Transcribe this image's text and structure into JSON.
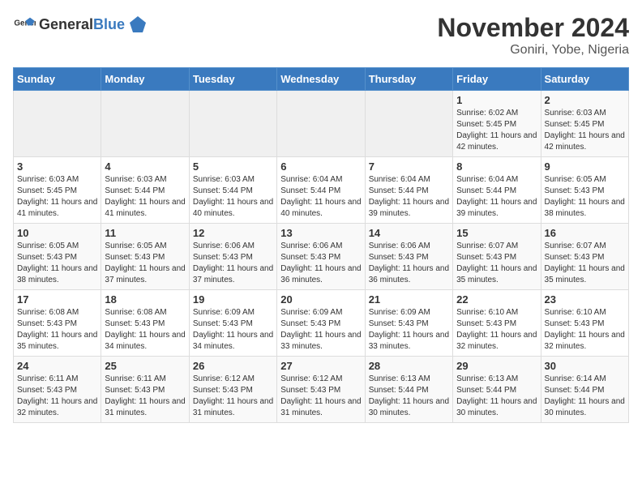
{
  "header": {
    "logo_general": "General",
    "logo_blue": "Blue",
    "month_year": "November 2024",
    "location": "Goniri, Yobe, Nigeria"
  },
  "weekdays": [
    "Sunday",
    "Monday",
    "Tuesday",
    "Wednesday",
    "Thursday",
    "Friday",
    "Saturday"
  ],
  "weeks": [
    [
      {
        "day": "",
        "info": ""
      },
      {
        "day": "",
        "info": ""
      },
      {
        "day": "",
        "info": ""
      },
      {
        "day": "",
        "info": ""
      },
      {
        "day": "",
        "info": ""
      },
      {
        "day": "1",
        "info": "Sunrise: 6:02 AM\nSunset: 5:45 PM\nDaylight: 11 hours and 42 minutes."
      },
      {
        "day": "2",
        "info": "Sunrise: 6:03 AM\nSunset: 5:45 PM\nDaylight: 11 hours and 42 minutes."
      }
    ],
    [
      {
        "day": "3",
        "info": "Sunrise: 6:03 AM\nSunset: 5:45 PM\nDaylight: 11 hours and 41 minutes."
      },
      {
        "day": "4",
        "info": "Sunrise: 6:03 AM\nSunset: 5:44 PM\nDaylight: 11 hours and 41 minutes."
      },
      {
        "day": "5",
        "info": "Sunrise: 6:03 AM\nSunset: 5:44 PM\nDaylight: 11 hours and 40 minutes."
      },
      {
        "day": "6",
        "info": "Sunrise: 6:04 AM\nSunset: 5:44 PM\nDaylight: 11 hours and 40 minutes."
      },
      {
        "day": "7",
        "info": "Sunrise: 6:04 AM\nSunset: 5:44 PM\nDaylight: 11 hours and 39 minutes."
      },
      {
        "day": "8",
        "info": "Sunrise: 6:04 AM\nSunset: 5:44 PM\nDaylight: 11 hours and 39 minutes."
      },
      {
        "day": "9",
        "info": "Sunrise: 6:05 AM\nSunset: 5:43 PM\nDaylight: 11 hours and 38 minutes."
      }
    ],
    [
      {
        "day": "10",
        "info": "Sunrise: 6:05 AM\nSunset: 5:43 PM\nDaylight: 11 hours and 38 minutes."
      },
      {
        "day": "11",
        "info": "Sunrise: 6:05 AM\nSunset: 5:43 PM\nDaylight: 11 hours and 37 minutes."
      },
      {
        "day": "12",
        "info": "Sunrise: 6:06 AM\nSunset: 5:43 PM\nDaylight: 11 hours and 37 minutes."
      },
      {
        "day": "13",
        "info": "Sunrise: 6:06 AM\nSunset: 5:43 PM\nDaylight: 11 hours and 36 minutes."
      },
      {
        "day": "14",
        "info": "Sunrise: 6:06 AM\nSunset: 5:43 PM\nDaylight: 11 hours and 36 minutes."
      },
      {
        "day": "15",
        "info": "Sunrise: 6:07 AM\nSunset: 5:43 PM\nDaylight: 11 hours and 35 minutes."
      },
      {
        "day": "16",
        "info": "Sunrise: 6:07 AM\nSunset: 5:43 PM\nDaylight: 11 hours and 35 minutes."
      }
    ],
    [
      {
        "day": "17",
        "info": "Sunrise: 6:08 AM\nSunset: 5:43 PM\nDaylight: 11 hours and 35 minutes."
      },
      {
        "day": "18",
        "info": "Sunrise: 6:08 AM\nSunset: 5:43 PM\nDaylight: 11 hours and 34 minutes."
      },
      {
        "day": "19",
        "info": "Sunrise: 6:09 AM\nSunset: 5:43 PM\nDaylight: 11 hours and 34 minutes."
      },
      {
        "day": "20",
        "info": "Sunrise: 6:09 AM\nSunset: 5:43 PM\nDaylight: 11 hours and 33 minutes."
      },
      {
        "day": "21",
        "info": "Sunrise: 6:09 AM\nSunset: 5:43 PM\nDaylight: 11 hours and 33 minutes."
      },
      {
        "day": "22",
        "info": "Sunrise: 6:10 AM\nSunset: 5:43 PM\nDaylight: 11 hours and 32 minutes."
      },
      {
        "day": "23",
        "info": "Sunrise: 6:10 AM\nSunset: 5:43 PM\nDaylight: 11 hours and 32 minutes."
      }
    ],
    [
      {
        "day": "24",
        "info": "Sunrise: 6:11 AM\nSunset: 5:43 PM\nDaylight: 11 hours and 32 minutes."
      },
      {
        "day": "25",
        "info": "Sunrise: 6:11 AM\nSunset: 5:43 PM\nDaylight: 11 hours and 31 minutes."
      },
      {
        "day": "26",
        "info": "Sunrise: 6:12 AM\nSunset: 5:43 PM\nDaylight: 11 hours and 31 minutes."
      },
      {
        "day": "27",
        "info": "Sunrise: 6:12 AM\nSunset: 5:43 PM\nDaylight: 11 hours and 31 minutes."
      },
      {
        "day": "28",
        "info": "Sunrise: 6:13 AM\nSunset: 5:44 PM\nDaylight: 11 hours and 30 minutes."
      },
      {
        "day": "29",
        "info": "Sunrise: 6:13 AM\nSunset: 5:44 PM\nDaylight: 11 hours and 30 minutes."
      },
      {
        "day": "30",
        "info": "Sunrise: 6:14 AM\nSunset: 5:44 PM\nDaylight: 11 hours and 30 minutes."
      }
    ]
  ]
}
